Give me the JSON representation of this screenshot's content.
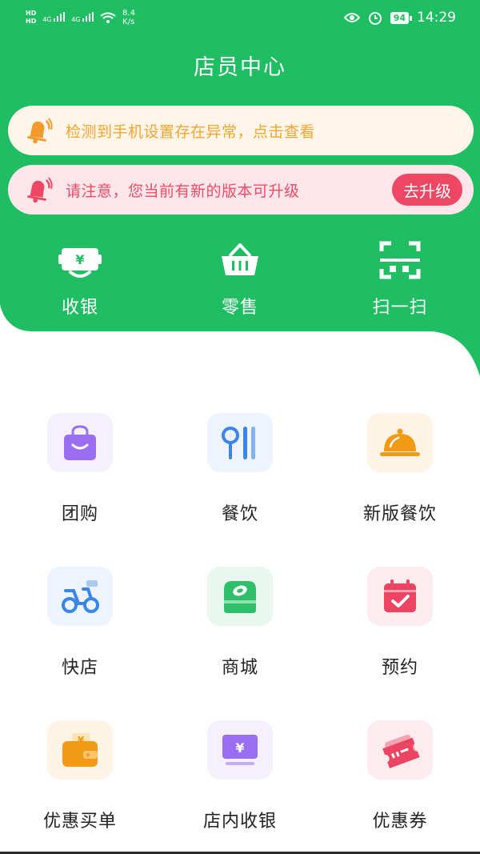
{
  "status_bar": {
    "network_top": "HD",
    "network_bottom": "HD",
    "signal_1": "4G",
    "signal_2": "4G",
    "speed_value": "8.4",
    "speed_unit": "K/s",
    "battery": "94",
    "time": "14:29"
  },
  "header": {
    "title": "店员中心"
  },
  "notices": [
    {
      "text": "检测到手机设置存在异常，点击查看",
      "icon": "bell-icon",
      "color": "#f3a431"
    },
    {
      "text": "请注意，您当前有新的版本可升级",
      "icon": "bell-icon",
      "color": "#ef4b66",
      "action": "去升级"
    }
  ],
  "quick_actions": [
    {
      "label": "收银",
      "icon": "cashier-icon"
    },
    {
      "label": "零售",
      "icon": "basket-icon"
    },
    {
      "label": "扫一扫",
      "icon": "scan-icon"
    }
  ],
  "grid": [
    {
      "label": "团购",
      "icon": "shopping-bag-icon",
      "tile_bg": "#f4f1fc"
    },
    {
      "label": "餐饮",
      "icon": "utensils-icon",
      "tile_bg": "#edf4fd"
    },
    {
      "label": "新版餐饮",
      "icon": "cloche-icon",
      "tile_bg": "#fdf4e6"
    },
    {
      "label": "快店",
      "icon": "scooter-icon",
      "tile_bg": "#edf4fd"
    },
    {
      "label": "商城",
      "icon": "store-icon",
      "tile_bg": "#e9f8ee"
    },
    {
      "label": "预约",
      "icon": "calendar-check-icon",
      "tile_bg": "#fdecef"
    },
    {
      "label": "优惠买单",
      "icon": "wallet-icon",
      "tile_bg": "#fdf4e6"
    },
    {
      "label": "店内收银",
      "icon": "monitor-yen-icon",
      "tile_bg": "#f4f1fc"
    },
    {
      "label": "优惠券",
      "icon": "ticket-icon",
      "tile_bg": "#fdecef"
    }
  ],
  "colors": {
    "brand_green": "#1fbe63",
    "white": "#ffffff"
  }
}
